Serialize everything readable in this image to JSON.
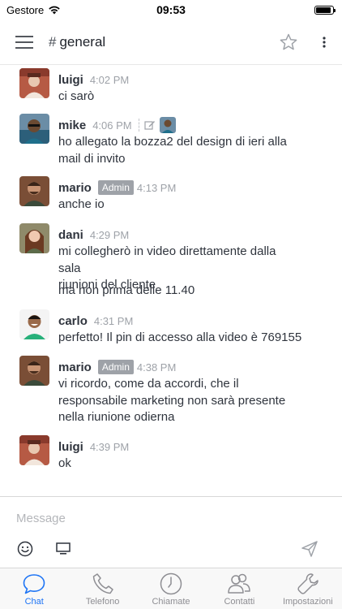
{
  "status_bar": {
    "carrier": "Gestore",
    "time": "09:53",
    "battery_level": 0.9
  },
  "header": {
    "channel_name": "general",
    "channel_prefix": "#",
    "icons": [
      "menu-icon",
      "star-icon",
      "more-vertical-icon"
    ]
  },
  "messages": [
    {
      "user": "luigi",
      "time": "4:02 PM",
      "admin": false,
      "text": [
        "ci sarò"
      ]
    },
    {
      "user": "mike",
      "time": "4:06 PM",
      "admin": false,
      "edited": true,
      "text": [
        "ho allegato la bozza2 del design di ieri alla",
        "mail di invito"
      ]
    },
    {
      "user": "mario",
      "time": "4:13 PM",
      "admin": true,
      "badge": "Admin",
      "text": [
        "anche io"
      ]
    },
    {
      "user": "dani",
      "time": "4:29 PM",
      "admin": false,
      "text": [
        "mi collegherò in video direttamente dalla sala",
        "riunioni del cliente"
      ],
      "extra_text": "ma non prima delle 11.40"
    },
    {
      "user": "carlo",
      "time": "4:31 PM",
      "admin": false,
      "text": [
        "perfetto! Il pin di accesso alla video è 769155"
      ]
    },
    {
      "user": "mario",
      "time": "4:38 PM",
      "admin": true,
      "badge": "Admin",
      "text": [
        "vi ricordo, come da accordi, che il",
        "responsabile marketing non sarà presente",
        "nella riunione odierna"
      ]
    },
    {
      "user": "luigi",
      "time": "4:39 PM",
      "admin": false,
      "text": [
        "ok"
      ]
    }
  ],
  "composer": {
    "placeholder": "Message",
    "icons": [
      "emoji-icon",
      "screen-share-icon",
      "send-icon"
    ]
  },
  "tabbar": {
    "tabs": [
      {
        "label": "Chat",
        "icon": "chat-bubble-icon",
        "active": true
      },
      {
        "label": "Telefono",
        "icon": "phone-icon",
        "active": false
      },
      {
        "label": "Chiamate",
        "icon": "clock-icon",
        "active": false
      },
      {
        "label": "Contatti",
        "icon": "contacts-icon",
        "active": false
      },
      {
        "label": "Impostazioni",
        "icon": "wrench-icon",
        "active": false
      }
    ]
  },
  "colors": {
    "accent": "#1d74f5",
    "badge": "#9ea2a8",
    "text": "#2f343d",
    "muted": "#9ea2a8"
  }
}
